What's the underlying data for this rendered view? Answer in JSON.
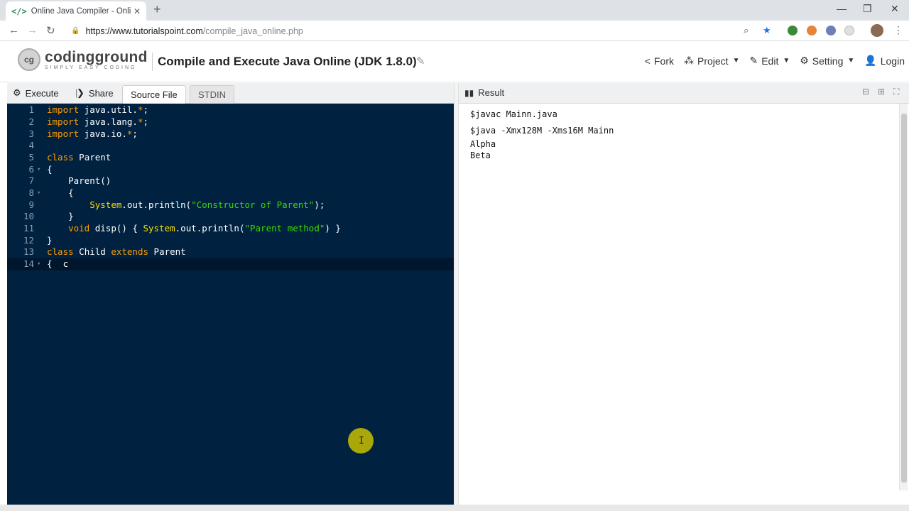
{
  "browser": {
    "tab_title": "Online Java Compiler - Online Ja",
    "tab_favicon": "</>",
    "url_host": "https://www.tutorialspoint.com",
    "url_path": "/compile_java_online.php"
  },
  "app": {
    "logo_main": "codingground",
    "logo_sub": "SIMPLY EASY CODING",
    "page_title": "Compile and Execute Java Online (JDK 1.8.0)",
    "nav": {
      "fork": "Fork",
      "project": "Project",
      "edit": "Edit",
      "setting": "Setting",
      "login": "Login"
    }
  },
  "toolbar": {
    "execute": "Execute",
    "share": "Share",
    "tabs": [
      "Source File",
      "STDIN"
    ]
  },
  "editor": {
    "line_numbers": [
      "1",
      "2",
      "3",
      "4",
      "5",
      "6",
      "7",
      "8",
      "9",
      "10",
      "11",
      "12",
      "13",
      "14"
    ]
  },
  "result": {
    "title": "Result",
    "lines": [
      "$javac Mainn.java",
      "$java -Xmx128M -Xms16M Mainn",
      "Alpha",
      "Beta"
    ]
  },
  "colors": {
    "editor_bg": "#002240",
    "keyword": "#ff9d00",
    "string": "#3ad900",
    "system": "#ffdd00"
  }
}
